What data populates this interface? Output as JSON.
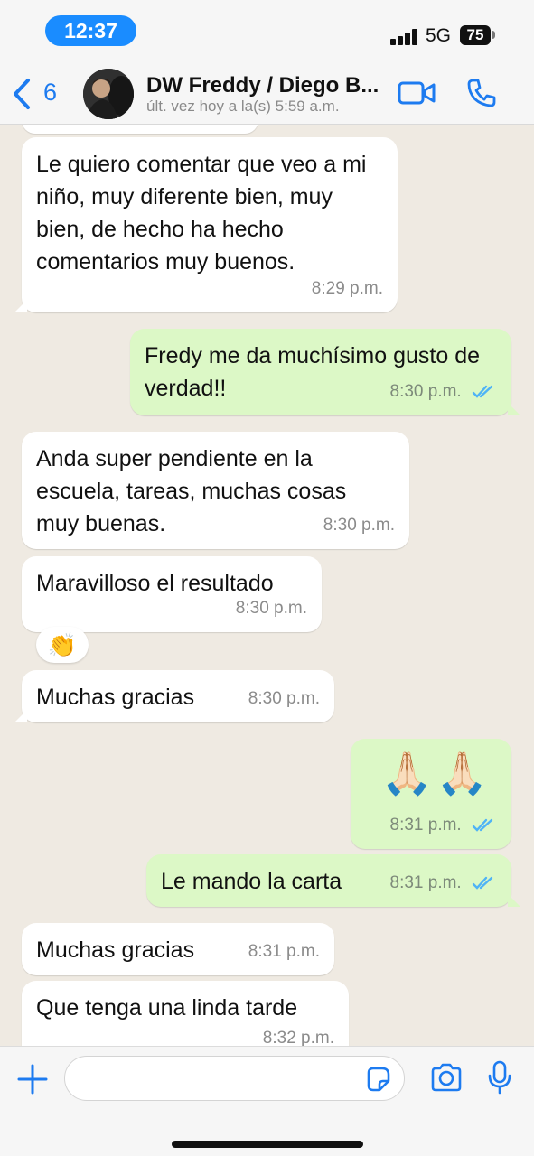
{
  "status_bar": {
    "time": "12:37",
    "network": "5G",
    "battery": "75"
  },
  "header": {
    "back_count": "6",
    "contact_name": "DW Freddy / Diego B...",
    "contact_status": "últ. vez hoy a la(s) 5:59 a.m.",
    "icons": [
      "chevron-left-icon",
      "video-call-icon",
      "phone-icon"
    ]
  },
  "messages": [
    {
      "direction": "in",
      "text": "Le quiero comentar que veo a mi niño, muy diferente bien, muy bien, de hecho ha hecho comentarios muy buenos.",
      "time": "8:29 p.m."
    },
    {
      "direction": "out",
      "text": "Fredy me da muchísimo gusto de verdad!!",
      "time": "8:30 p.m.",
      "read": true
    },
    {
      "direction": "in",
      "text": "Anda super pendiente en la escuela, tareas, muchas cosas muy buenas.",
      "time": "8:30 p.m."
    },
    {
      "direction": "in",
      "text": "Maravilloso el resultado",
      "time": "8:30 p.m.",
      "reaction": "👏"
    },
    {
      "direction": "in",
      "text": "Muchas gracias",
      "time": "8:30 p.m."
    },
    {
      "direction": "out",
      "text": "🙏🏻🙏🏻",
      "time": "8:31 p.m.",
      "read": true
    },
    {
      "direction": "out",
      "text": "Le mando la carta",
      "time": "8:31 p.m.",
      "read": true
    },
    {
      "direction": "in",
      "text": "Muchas gracias",
      "time": "8:31 p.m."
    },
    {
      "direction": "in",
      "text": "Que tenga una linda tarde",
      "time": "8:32 p.m."
    }
  ],
  "input": {
    "placeholder": "",
    "icons": [
      "plus-icon",
      "sticker-icon",
      "camera-icon",
      "microphone-icon"
    ]
  },
  "colors": {
    "accent": "#1d7bf0",
    "incoming_bubble": "#ffffff",
    "outgoing_bubble": "#dcf8c6",
    "chat_background": "#efeae2",
    "read_ticks": "#4fb3f6"
  }
}
